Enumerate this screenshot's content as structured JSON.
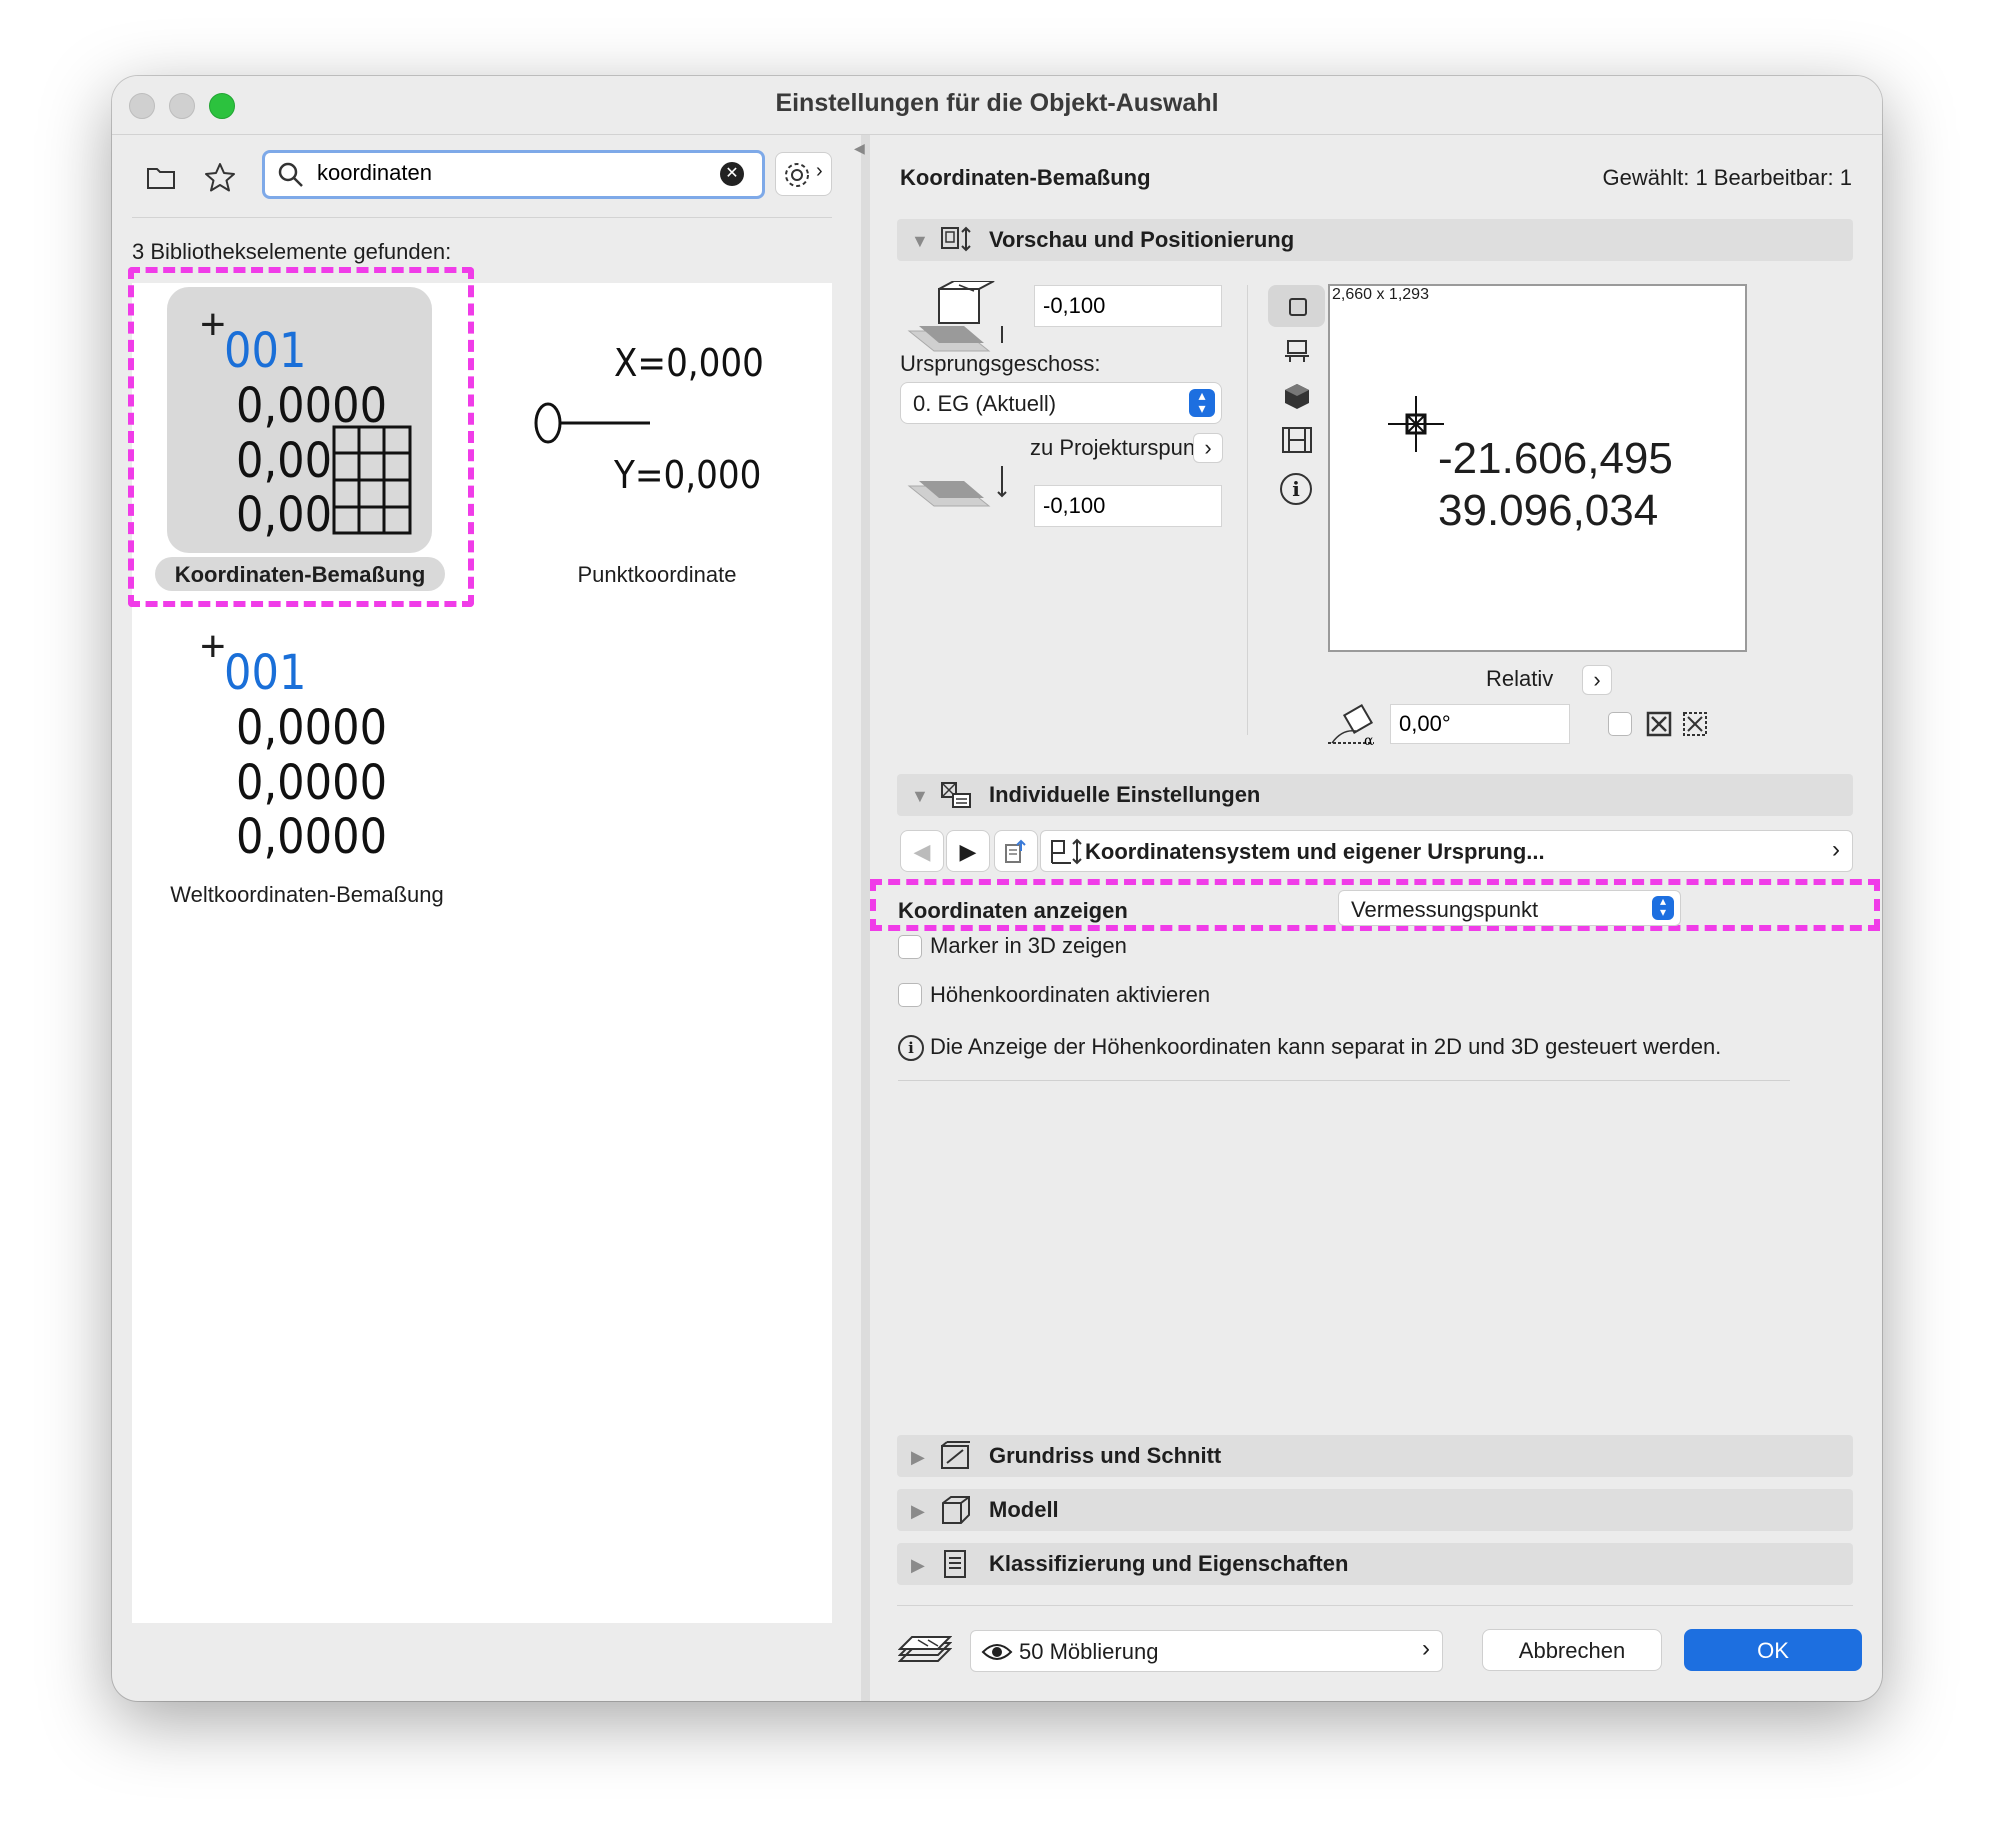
{
  "window": {
    "title": "Einstellungen für die Objekt-Auswahl"
  },
  "search": {
    "value": "koordinaten"
  },
  "left": {
    "found_label": "3 Bibliothekselemente gefunden:",
    "items": [
      {
        "label": "Koordinaten-Bemaßung",
        "thumb_lines": [
          "001",
          "0,0000",
          "0,00",
          "0,00"
        ]
      },
      {
        "label": "Punktkoordinate",
        "thumb_lines": [
          "X=0,000",
          "Y=0,000"
        ]
      },
      {
        "label": "Weltkoordinaten-Bemaßung",
        "thumb_lines": [
          "001",
          "0,0000",
          "0,0000",
          "0,0000"
        ]
      }
    ]
  },
  "right": {
    "object_name": "Koordinaten-Bemaßung",
    "selection_info": "Gewählt: 1 Bearbeitbar: 1",
    "section_preview": "Vorschau und Positionierung",
    "offset_top": "-0,100",
    "origin_floor_label": "Ursprungsgeschoss:",
    "origin_floor_value": "0. EG (Aktuell)",
    "project_origin_label": "zu Projekturspung",
    "offset_bottom": "-0,100",
    "preview_size": "2,660 x 1,293",
    "preview_values": [
      "-21.606,495",
      "39.096,034"
    ],
    "relative_label": "Relativ",
    "angle_value": "0,00°",
    "section_individual": "Individuelle Einstellungen",
    "page_nav_title": "Koordinatensystem und eigener Ursprung...",
    "show_coords_label": "Koordinaten anzeigen",
    "show_coords_value": "Vermessungspunkt",
    "marker_3d_label": "Marker in 3D zeigen",
    "height_coords_label": "Höhenkoordinaten aktivieren",
    "info_text": "Die Anzeige der Höhenkoordinaten kann separat in 2D und 3D gesteuert werden.",
    "section_floorplan": "Grundriss und Schnitt",
    "section_model": "Modell",
    "section_classification": "Klassifizierung und Eigenschaften",
    "layer_value": "50 Möblierung",
    "cancel_label": "Abbrechen",
    "ok_label": "OK"
  },
  "colors": {
    "accent": "#1d6fe0",
    "highlight": "#f03ce8"
  }
}
